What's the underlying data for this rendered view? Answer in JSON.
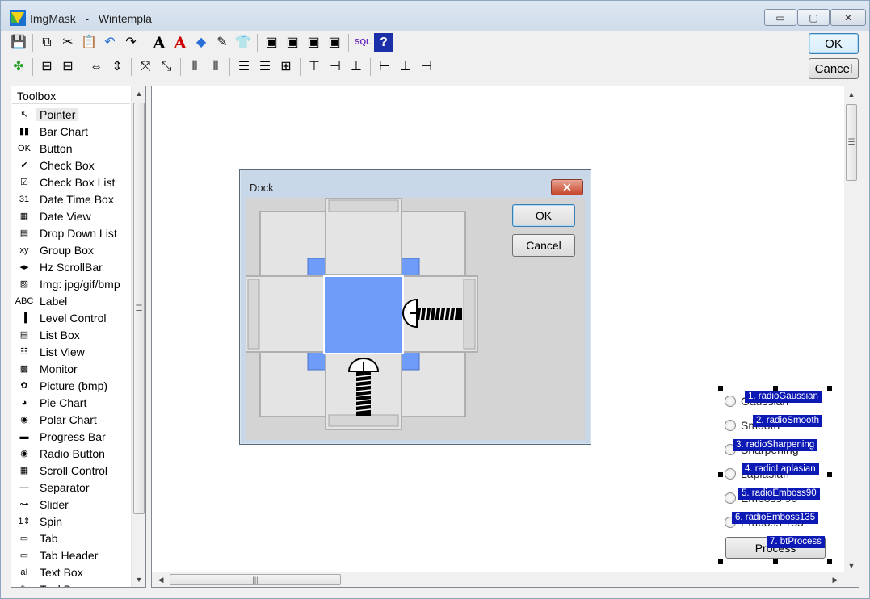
{
  "window": {
    "app_name": "ImgMask",
    "separator": "-",
    "document": "Wintempla",
    "min_glyph": "▭",
    "max_glyph": "▢",
    "close_glyph": "✕"
  },
  "top_buttons": {
    "ok": "OK",
    "cancel": "Cancel"
  },
  "toolbar": {
    "row1": [
      {
        "icon": "save-icon",
        "glyph": "💾"
      },
      {
        "icon": "copy-icon",
        "glyph": "⧉"
      },
      {
        "icon": "cut-icon",
        "glyph": "✂"
      },
      {
        "icon": "paste-icon",
        "glyph": "📋"
      },
      {
        "icon": "undo-icon",
        "glyph": "↶"
      },
      {
        "icon": "redo-icon",
        "glyph": "↷"
      },
      {
        "icon": "font-icon",
        "glyph": "A"
      },
      {
        "icon": "font-color-icon",
        "glyph": "A"
      },
      {
        "icon": "fill-color-icon",
        "glyph": "◆"
      },
      {
        "icon": "crayons-icon",
        "glyph": "✎"
      },
      {
        "icon": "tshirt-icon",
        "glyph": "👕"
      },
      {
        "icon": "bring-front-icon",
        "glyph": "▣"
      },
      {
        "icon": "send-back-icon",
        "glyph": "▣"
      },
      {
        "icon": "bring-forward-icon",
        "glyph": "▣"
      },
      {
        "icon": "send-backward-icon",
        "glyph": "▣"
      },
      {
        "icon": "sql-icon",
        "glyph": "SQL"
      },
      {
        "icon": "help-icon",
        "glyph": "?"
      }
    ],
    "row2": [
      {
        "icon": "clover-icon",
        "glyph": "✤"
      },
      {
        "icon": "center-horizontal-icon",
        "glyph": "⊟"
      },
      {
        "icon": "center-vertical-icon",
        "glyph": "⊟"
      },
      {
        "icon": "same-width-icon",
        "glyph": "⇔"
      },
      {
        "icon": "same-height-icon",
        "glyph": "⇕"
      },
      {
        "icon": "expand-icon",
        "glyph": "⤧"
      },
      {
        "icon": "shrink-icon",
        "glyph": "⤡"
      },
      {
        "icon": "space-across-icon",
        "glyph": "⦀"
      },
      {
        "icon": "space-evenly-icon",
        "glyph": "⦀"
      },
      {
        "icon": "space-down-icon",
        "glyph": "☰"
      },
      {
        "icon": "space-rows-icon",
        "glyph": "☰"
      },
      {
        "icon": "tab-order-icon",
        "glyph": "⊞"
      },
      {
        "icon": "align-top-icon",
        "glyph": "⊤"
      },
      {
        "icon": "align-middle-icon",
        "glyph": "⊣"
      },
      {
        "icon": "align-bottom-icon",
        "glyph": "⊥"
      },
      {
        "icon": "align-left-icon",
        "glyph": "⊢"
      },
      {
        "icon": "align-center-icon",
        "glyph": "⊥"
      },
      {
        "icon": "align-right-icon",
        "glyph": "⊣"
      }
    ]
  },
  "toolbox": {
    "title": "Toolbox",
    "items": [
      {
        "label": "Pointer",
        "icon": "pointer-icon",
        "glyph": "↖",
        "selected": true
      },
      {
        "label": "Bar Chart",
        "icon": "bar-chart-icon",
        "glyph": "▮▮"
      },
      {
        "label": "Button",
        "icon": "button-icon",
        "glyph": "OK"
      },
      {
        "label": "Check Box",
        "icon": "check-box-icon",
        "glyph": "✔"
      },
      {
        "label": "Check Box List",
        "icon": "check-box-list-icon",
        "glyph": "☑"
      },
      {
        "label": "Date Time Box",
        "icon": "date-time-box-icon",
        "glyph": "31"
      },
      {
        "label": "Date View",
        "icon": "date-view-icon",
        "glyph": "▦"
      },
      {
        "label": "Drop Down List",
        "icon": "drop-down-list-icon",
        "glyph": "▤"
      },
      {
        "label": "Group Box",
        "icon": "group-box-icon",
        "glyph": "xy"
      },
      {
        "label": "Hz ScrollBar",
        "icon": "hz-scrollbar-icon",
        "glyph": "◂▸"
      },
      {
        "label": "Img: jpg/gif/bmp",
        "icon": "image-icon",
        "glyph": "▨"
      },
      {
        "label": "Label",
        "icon": "label-icon",
        "glyph": "ABC"
      },
      {
        "label": "Level Control",
        "icon": "level-control-icon",
        "glyph": "▐"
      },
      {
        "label": "List Box",
        "icon": "list-box-icon",
        "glyph": "▤"
      },
      {
        "label": "List View",
        "icon": "list-view-icon",
        "glyph": "☷"
      },
      {
        "label": "Monitor",
        "icon": "monitor-icon",
        "glyph": "▩"
      },
      {
        "label": "Picture (bmp)",
        "icon": "picture-icon",
        "glyph": "✿"
      },
      {
        "label": "Pie Chart",
        "icon": "pie-chart-icon",
        "glyph": "◕"
      },
      {
        "label": "Polar Chart",
        "icon": "polar-chart-icon",
        "glyph": "◉"
      },
      {
        "label": "Progress Bar",
        "icon": "progress-bar-icon",
        "glyph": "▬"
      },
      {
        "label": "Radio Button",
        "icon": "radio-button-icon",
        "glyph": "◉"
      },
      {
        "label": "Scroll Control",
        "icon": "scroll-control-icon",
        "glyph": "▦"
      },
      {
        "label": "Separator",
        "icon": "separator-icon",
        "glyph": "—"
      },
      {
        "label": "Slider",
        "icon": "slider-icon",
        "glyph": "⊶"
      },
      {
        "label": "Spin",
        "icon": "spin-icon",
        "glyph": "1⇕"
      },
      {
        "label": "Tab",
        "icon": "tab-icon",
        "glyph": "▭"
      },
      {
        "label": "Tab Header",
        "icon": "tab-header-icon",
        "glyph": "▭"
      },
      {
        "label": "Text Box",
        "icon": "text-box-icon",
        "glyph": "aI"
      },
      {
        "label": "Tool Bar",
        "icon": "tool-bar-icon",
        "glyph": "✎"
      }
    ]
  },
  "dock": {
    "title": "Dock",
    "close_glyph": "✕",
    "ok": "OK",
    "cancel": "Cancel"
  },
  "radio_group": {
    "rows": [
      {
        "text": "Gaussian",
        "tag": "1. radioGaussian"
      },
      {
        "text": "Smooth",
        "tag": "2. radioSmooth"
      },
      {
        "text": "Sharpening",
        "tag": "3. radioSharpening"
      },
      {
        "text": "Laplasian",
        "tag": "4. radioLaplasian"
      },
      {
        "text": "Emboss 90",
        "tag": "5. radioEmboss90"
      },
      {
        "text": "Emboss 135",
        "tag": "6. radioEmboss135"
      }
    ],
    "process_label": "Process",
    "process_tag": "7. btProcess"
  },
  "colors": {
    "dock_blue": "#6e9cf8",
    "tag_blue": "#0c19b5",
    "title_gradient_top": "#dde7f3"
  }
}
